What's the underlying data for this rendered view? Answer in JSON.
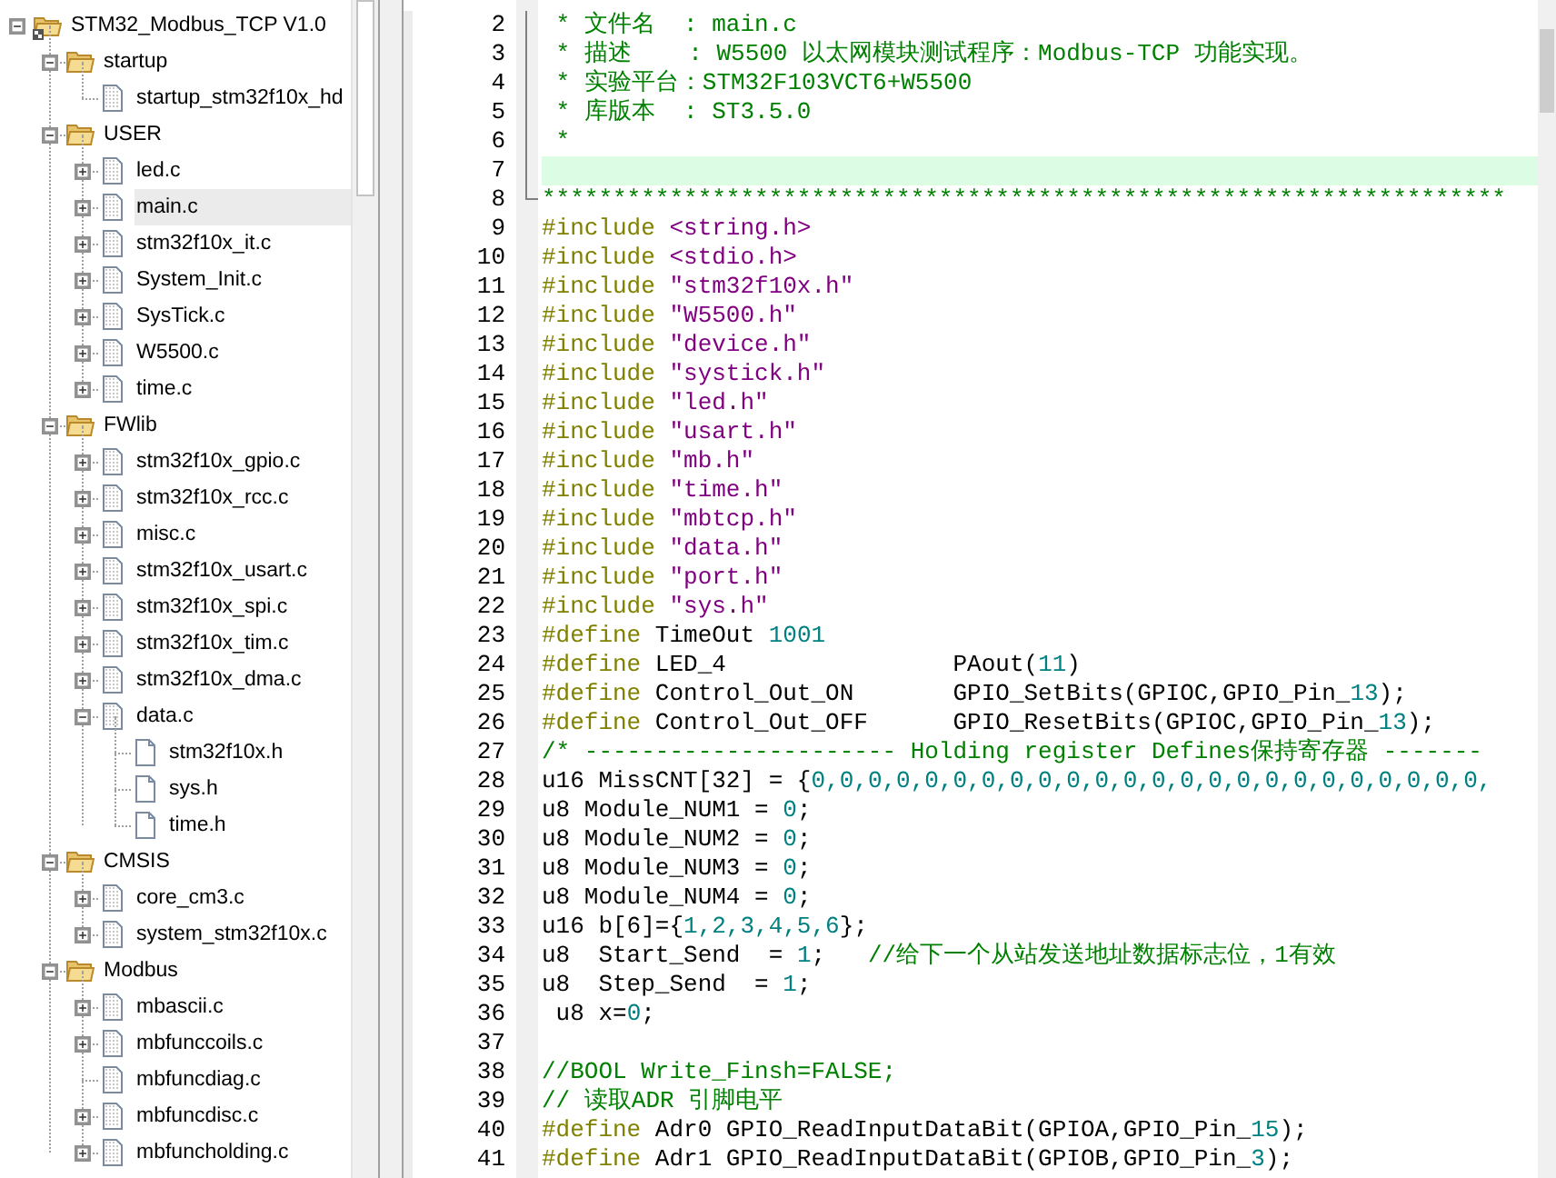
{
  "project_tree": [
    {
      "label": "STM32_Modbus_TCP V1.0",
      "kind": "project",
      "expanded": true,
      "selected": false,
      "children": [
        {
          "label": "startup",
          "kind": "folder",
          "expanded": true,
          "selected": false,
          "children": [
            {
              "label": "startup_stm32f10x_hd",
              "kind": "source",
              "selected": false
            }
          ]
        },
        {
          "label": "USER",
          "kind": "folder",
          "expanded": true,
          "selected": false,
          "children": [
            {
              "label": "led.c",
              "kind": "source",
              "expanded": false,
              "selected": false
            },
            {
              "label": "main.c",
              "kind": "source",
              "expanded": false,
              "selected": true
            },
            {
              "label": "stm32f10x_it.c",
              "kind": "source",
              "expanded": false,
              "selected": false
            },
            {
              "label": "System_Init.c",
              "kind": "source",
              "expanded": false,
              "selected": false
            },
            {
              "label": "SysTick.c",
              "kind": "source",
              "expanded": false,
              "selected": false
            },
            {
              "label": "W5500.c",
              "kind": "source",
              "expanded": false,
              "selected": false
            },
            {
              "label": "time.c",
              "kind": "source",
              "expanded": false,
              "selected": false
            }
          ]
        },
        {
          "label": "FWlib",
          "kind": "folder",
          "expanded": true,
          "selected": false,
          "children": [
            {
              "label": "stm32f10x_gpio.c",
              "kind": "source",
              "expanded": false,
              "selected": false
            },
            {
              "label": "stm32f10x_rcc.c",
              "kind": "source",
              "expanded": false,
              "selected": false
            },
            {
              "label": "misc.c",
              "kind": "source",
              "expanded": false,
              "selected": false
            },
            {
              "label": "stm32f10x_usart.c",
              "kind": "source",
              "expanded": false,
              "selected": false
            },
            {
              "label": "stm32f10x_spi.c",
              "kind": "source",
              "expanded": false,
              "selected": false
            },
            {
              "label": "stm32f10x_tim.c",
              "kind": "source",
              "expanded": false,
              "selected": false
            },
            {
              "label": "stm32f10x_dma.c",
              "kind": "source",
              "expanded": false,
              "selected": false
            },
            {
              "label": "data.c",
              "kind": "source",
              "expanded": true,
              "selected": false,
              "children": [
                {
                  "label": "stm32f10x.h",
                  "kind": "header",
                  "selected": false
                },
                {
                  "label": "sys.h",
                  "kind": "header",
                  "selected": false
                },
                {
                  "label": "time.h",
                  "kind": "header",
                  "selected": false
                }
              ]
            }
          ]
        },
        {
          "label": "CMSIS",
          "kind": "folder",
          "expanded": true,
          "selected": false,
          "children": [
            {
              "label": "core_cm3.c",
              "kind": "source",
              "expanded": false,
              "selected": false
            },
            {
              "label": "system_stm32f10x.c",
              "kind": "source",
              "expanded": false,
              "selected": false
            }
          ]
        },
        {
          "label": "Modbus",
          "kind": "folder",
          "expanded": true,
          "selected": false,
          "children": [
            {
              "label": "mbascii.c",
              "kind": "source",
              "expanded": false,
              "selected": false
            },
            {
              "label": "mbfunccoils.c",
              "kind": "source",
              "expanded": false,
              "selected": false
            },
            {
              "label": "mbfuncdiag.c",
              "kind": "source",
              "selected": false
            },
            {
              "label": "mbfuncdisc.c",
              "kind": "source",
              "expanded": false,
              "selected": false
            },
            {
              "label": "mbfuncholding.c",
              "kind": "source",
              "expanded": false,
              "selected": false
            }
          ]
        }
      ]
    }
  ],
  "editor": {
    "lines": [
      {
        "number": "2",
        "current": false,
        "segments": [
          {
            "kind": "comment",
            "text": " * 文件名  : main.c"
          }
        ]
      },
      {
        "number": "3",
        "current": false,
        "segments": [
          {
            "kind": "comment",
            "text": " * 描述    : W5500 以太网模块测试程序：Modbus-TCP 功能实现。"
          }
        ]
      },
      {
        "number": "4",
        "current": false,
        "segments": [
          {
            "kind": "comment",
            "text": " * 实验平台：STM32F103VCT6+W5500"
          }
        ]
      },
      {
        "number": "5",
        "current": false,
        "segments": [
          {
            "kind": "comment",
            "text": " * 库版本  : ST3.5.0"
          }
        ]
      },
      {
        "number": "6",
        "current": false,
        "segments": [
          {
            "kind": "comment",
            "text": " *"
          }
        ]
      },
      {
        "number": "7",
        "current": true
      },
      {
        "number": "8",
        "current": false,
        "segments": [
          {
            "kind": "comment",
            "text": "********************************************************************"
          }
        ]
      },
      {
        "number": "9",
        "current": false,
        "segments": [
          {
            "kind": "directive",
            "text": "#include "
          },
          {
            "kind": "string",
            "text": "<string.h>"
          }
        ]
      },
      {
        "number": "10",
        "current": false,
        "segments": [
          {
            "kind": "directive",
            "text": "#include "
          },
          {
            "kind": "string",
            "text": "<stdio.h>"
          }
        ]
      },
      {
        "number": "11",
        "current": false,
        "segments": [
          {
            "kind": "directive",
            "text": "#include "
          },
          {
            "kind": "string",
            "text": "\"stm32f10x.h\""
          }
        ]
      },
      {
        "number": "12",
        "current": false,
        "segments": [
          {
            "kind": "directive",
            "text": "#include "
          },
          {
            "kind": "string",
            "text": "\"W5500.h\""
          }
        ]
      },
      {
        "number": "13",
        "current": false,
        "segments": [
          {
            "kind": "directive",
            "text": "#include "
          },
          {
            "kind": "string",
            "text": "\"device.h\""
          }
        ]
      },
      {
        "number": "14",
        "current": false,
        "segments": [
          {
            "kind": "directive",
            "text": "#include "
          },
          {
            "kind": "string",
            "text": "\"systick.h\""
          }
        ]
      },
      {
        "number": "15",
        "current": false,
        "segments": [
          {
            "kind": "directive",
            "text": "#include "
          },
          {
            "kind": "string",
            "text": "\"led.h\""
          }
        ]
      },
      {
        "number": "16",
        "current": false,
        "segments": [
          {
            "kind": "directive",
            "text": "#include "
          },
          {
            "kind": "string",
            "text": "\"usart.h\""
          }
        ]
      },
      {
        "number": "17",
        "current": false,
        "segments": [
          {
            "kind": "directive",
            "text": "#include "
          },
          {
            "kind": "string",
            "text": "\"mb.h\""
          }
        ]
      },
      {
        "number": "18",
        "current": false,
        "segments": [
          {
            "kind": "directive",
            "text": "#include "
          },
          {
            "kind": "string",
            "text": "\"time.h\""
          }
        ]
      },
      {
        "number": "19",
        "current": false,
        "segments": [
          {
            "kind": "directive",
            "text": "#include "
          },
          {
            "kind": "string",
            "text": "\"mbtcp.h\""
          }
        ]
      },
      {
        "number": "20",
        "current": false,
        "segments": [
          {
            "kind": "directive",
            "text": "#include "
          },
          {
            "kind": "string",
            "text": "\"data.h\""
          }
        ]
      },
      {
        "number": "21",
        "current": false,
        "segments": [
          {
            "kind": "directive",
            "text": "#include "
          },
          {
            "kind": "string",
            "text": "\"port.h\""
          }
        ]
      },
      {
        "number": "22",
        "current": false,
        "segments": [
          {
            "kind": "directive",
            "text": "#include "
          },
          {
            "kind": "string",
            "text": "\"sys.h\""
          }
        ]
      },
      {
        "number": "23",
        "current": false,
        "segments": [
          {
            "kind": "directive",
            "text": "#define "
          },
          {
            "kind": "plain",
            "text": "TimeOut "
          },
          {
            "kind": "number",
            "text": "1001"
          }
        ]
      },
      {
        "number": "24",
        "current": false,
        "segments": [
          {
            "kind": "directive",
            "text": "#define "
          },
          {
            "kind": "plain",
            "text": "LED_4                PAout("
          },
          {
            "kind": "number",
            "text": "11"
          },
          {
            "kind": "plain",
            "text": ")"
          }
        ]
      },
      {
        "number": "25",
        "current": false,
        "segments": [
          {
            "kind": "directive",
            "text": "#define "
          },
          {
            "kind": "plain",
            "text": "Control_Out_ON       GPIO_SetBits(GPIOC,GPIO_Pin_"
          },
          {
            "kind": "number",
            "text": "13"
          },
          {
            "kind": "plain",
            "text": ");"
          }
        ]
      },
      {
        "number": "26",
        "current": false,
        "segments": [
          {
            "kind": "directive",
            "text": "#define "
          },
          {
            "kind": "plain",
            "text": "Control_Out_OFF      GPIO_ResetBits(GPIOC,GPIO_Pin_"
          },
          {
            "kind": "number",
            "text": "13"
          },
          {
            "kind": "plain",
            "text": ");"
          }
        ]
      },
      {
        "number": "27",
        "current": false,
        "segments": [
          {
            "kind": "comment",
            "text": "/* ---------------------- Holding register Defines保持寄存器 -------"
          }
        ]
      },
      {
        "number": "28",
        "current": false,
        "segments": [
          {
            "kind": "plain",
            "text": "u16 MissCNT[32] = {"
          },
          {
            "kind": "number",
            "text": "0,0,0,0,0,0,0,0,0,0,0,0,0,0,0,0,0,0,0,0,0,0,0,0,"
          }
        ]
      },
      {
        "number": "29",
        "current": false,
        "segments": [
          {
            "kind": "plain",
            "text": "u8 Module_NUM1 = "
          },
          {
            "kind": "number",
            "text": "0"
          },
          {
            "kind": "plain",
            "text": ";"
          }
        ]
      },
      {
        "number": "30",
        "current": false,
        "segments": [
          {
            "kind": "plain",
            "text": "u8 Module_NUM2 = "
          },
          {
            "kind": "number",
            "text": "0"
          },
          {
            "kind": "plain",
            "text": ";"
          }
        ]
      },
      {
        "number": "31",
        "current": false,
        "segments": [
          {
            "kind": "plain",
            "text": "u8 Module_NUM3 = "
          },
          {
            "kind": "number",
            "text": "0"
          },
          {
            "kind": "plain",
            "text": ";"
          }
        ]
      },
      {
        "number": "32",
        "current": false,
        "segments": [
          {
            "kind": "plain",
            "text": "u8 Module_NUM4 = "
          },
          {
            "kind": "number",
            "text": "0"
          },
          {
            "kind": "plain",
            "text": ";"
          }
        ]
      },
      {
        "number": "33",
        "current": false,
        "segments": [
          {
            "kind": "plain",
            "text": "u16 b[6]={"
          },
          {
            "kind": "number",
            "text": "1,2,3,4,5,6"
          },
          {
            "kind": "plain",
            "text": "};"
          }
        ]
      },
      {
        "number": "34",
        "current": false,
        "segments": [
          {
            "kind": "plain",
            "text": "u8  Start_Send  = "
          },
          {
            "kind": "number",
            "text": "1"
          },
          {
            "kind": "plain",
            "text": ";   "
          },
          {
            "kind": "comment",
            "text": "//给下一个从站发送地址数据标志位，1有效"
          }
        ]
      },
      {
        "number": "35",
        "current": false,
        "segments": [
          {
            "kind": "plain",
            "text": "u8  Step_Send  = "
          },
          {
            "kind": "number",
            "text": "1"
          },
          {
            "kind": "plain",
            "text": ";"
          }
        ]
      },
      {
        "number": "36",
        "current": false,
        "segments": [
          {
            "kind": "plain",
            "text": " u8 x="
          },
          {
            "kind": "number",
            "text": "0"
          },
          {
            "kind": "plain",
            "text": ";"
          }
        ]
      },
      {
        "number": "37",
        "current": false
      },
      {
        "number": "38",
        "current": false,
        "segments": [
          {
            "kind": "comment",
            "text": "//BOOL Write_Finsh=FALSE;"
          }
        ]
      },
      {
        "number": "39",
        "current": false,
        "segments": [
          {
            "kind": "comment",
            "text": "// 读取ADR 引脚电平"
          }
        ]
      },
      {
        "number": "40",
        "current": false,
        "segments": [
          {
            "kind": "directive",
            "text": "#define "
          },
          {
            "kind": "plain",
            "text": "Adr0 GPIO_ReadInputDataBit(GPIOA,GPIO_Pin_"
          },
          {
            "kind": "number",
            "text": "15"
          },
          {
            "kind": "plain",
            "text": ");"
          }
        ]
      },
      {
        "number": "41",
        "current": false,
        "segments": [
          {
            "kind": "directive",
            "text": "#define "
          },
          {
            "kind": "plain",
            "text": "Adr1 GPIO_ReadInputDataBit(GPIOB,GPIO_Pin_"
          },
          {
            "kind": "number",
            "text": "3"
          },
          {
            "kind": "plain",
            "text": ");"
          }
        ]
      }
    ]
  }
}
